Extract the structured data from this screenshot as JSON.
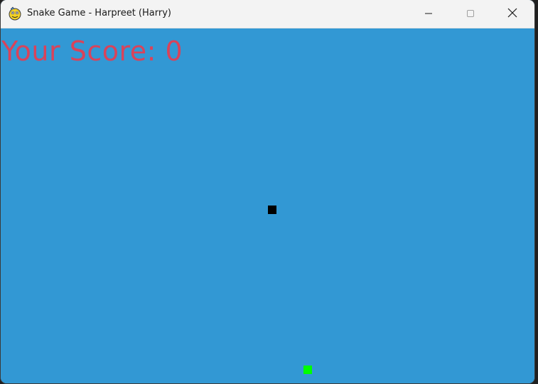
{
  "window": {
    "title": "Snake Game - Harpreet (Harry)",
    "app_icon": "pygame-snake-icon",
    "controls": {
      "minimize_icon": "minimize-icon",
      "maximize_icon": "maximize-icon",
      "close_icon": "close-icon"
    }
  },
  "game": {
    "score_label": "Your Score: 0",
    "background_color": "#3298d4",
    "score_color": "#d9435a",
    "snake_color": "#000000",
    "food_color": "#00ff00"
  }
}
